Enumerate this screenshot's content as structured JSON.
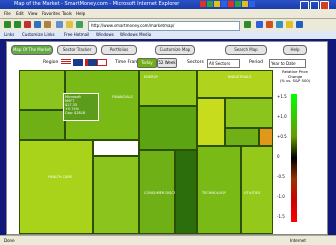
{
  "window": {
    "title": "Map of the Market - SmartMoney.com - Microsoft Internet Explorer"
  },
  "menu": [
    "File",
    "Edit",
    "View",
    "Favorites",
    "Tools",
    "Help"
  ],
  "address": {
    "value": "http://www.smartmoney.com/marketmap/"
  },
  "links": [
    "Links",
    "Customize Links",
    "Free Hotmail",
    "Windows",
    "Windows Media"
  ],
  "app": {
    "tabs": [
      "Map Of The Market",
      "Sector Tracker",
      "Portfolios",
      "Customize Map"
    ],
    "search_button": "Search Map",
    "help_button": "Help",
    "region_label": "Region",
    "time_label": "Time Frame",
    "time_options": [
      "Today",
      "52 Week"
    ],
    "sector_label": "Sectors",
    "sector_value": "All Sectors",
    "period_label": "Period",
    "period_value": "Year to Date"
  },
  "treemap": {
    "cells": [
      {
        "name": "CONSUMER STAPLES",
        "color": "#8cc41e"
      },
      {
        "name": "HEALTH CARE",
        "color": "#a9d21a"
      },
      {
        "name": "FINANCIALS",
        "color": "#7aba16"
      },
      {
        "name": "ENERGY",
        "color": "#94c81a"
      },
      {
        "name": "TELECOM",
        "color": "#d5e01a"
      },
      {
        "name": "CONSUMER DISCR.",
        "color": "#6fb016"
      },
      {
        "name": "TECHNOLOGY",
        "color": "#5ca412"
      },
      {
        "name": "INDUSTRIALS",
        "color": "#b0d41e"
      },
      {
        "name": "MATERIALS",
        "color": "#c8dc1e"
      },
      {
        "name": "UTILITIES",
        "color": "#e2961a"
      }
    ],
    "tooltip": [
      "Microsoft",
      "MSFT",
      "$27.35",
      "+0.74%",
      "Cap: $281B"
    ]
  },
  "legend": {
    "title": "Relative Price\nChange\n(% vs. S&P 500)",
    "ticks": [
      "+1.5",
      "+1.0",
      "+0.5",
      "0",
      "-0.5",
      "-1.0",
      "-1.5"
    ],
    "colors": [
      "#00ff00",
      "#33cc00",
      "#669900",
      "#000000",
      "#993300",
      "#cc0000",
      "#ff0000"
    ]
  },
  "status": {
    "left": "Done",
    "right": "Internet"
  }
}
